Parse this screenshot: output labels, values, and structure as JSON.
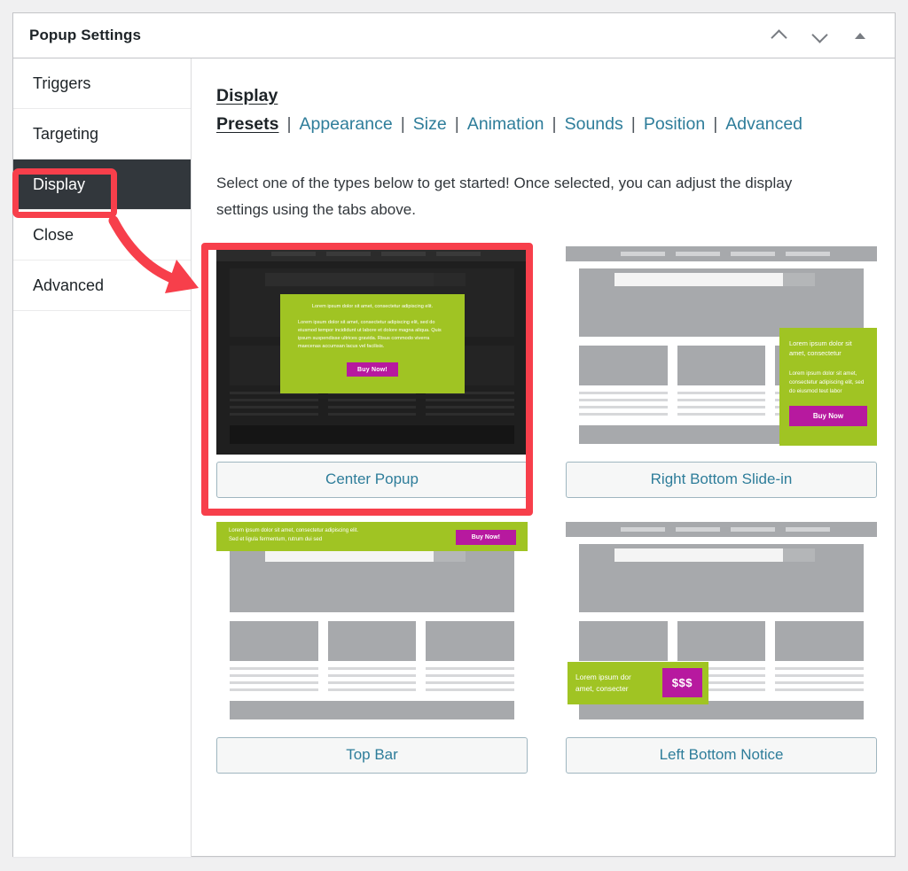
{
  "header": {
    "title": "Popup Settings",
    "controls": [
      {
        "name": "move-up-icon",
        "label": "Move up"
      },
      {
        "name": "move-down-icon",
        "label": "Move down"
      },
      {
        "name": "toggle-panel-icon",
        "label": "Toggle panel"
      }
    ]
  },
  "sidebar": {
    "items": [
      {
        "label": "Triggers",
        "active": false
      },
      {
        "label": "Targeting",
        "active": false
      },
      {
        "label": "Display",
        "active": true
      },
      {
        "label": "Close",
        "active": false
      },
      {
        "label": "Advanced",
        "active": false
      }
    ]
  },
  "tabs": [
    {
      "label": "Display Presets",
      "active": true
    },
    {
      "label": "Appearance",
      "active": false
    },
    {
      "label": "Size",
      "active": false
    },
    {
      "label": "Animation",
      "active": false
    },
    {
      "label": "Sounds",
      "active": false
    },
    {
      "label": "Position",
      "active": false
    },
    {
      "label": "Advanced",
      "active": false
    }
  ],
  "tab_separator": "|",
  "intro": "Select one of the types below to get started! Once selected, you can adjust the display settings using the tabs above.",
  "presets": {
    "center": {
      "label": "Center Popup",
      "selected": true,
      "popup": {
        "heading": "Lorem ipsum dolor sit amet, consectetur adipiscing elit.",
        "body": "Lorem ipsum dolor sit amet, consectetur adipiscing elit, sed do eiusmod tempor incididunt ut labore et dolore magna aliqua. Quis ipsum suspendisse ultrices gravida. Risus commodo viverra maecenas accumsan lacus vel facilisis.",
        "button": "Buy Now!"
      }
    },
    "slidein": {
      "label": "Right Bottom Slide-in",
      "selected": false,
      "popup": {
        "heading": "Lorem ipsum dolor sit amet, consectetur",
        "body": "Lorem ipsum dolor sit amet, consectetur adipiscing elit, sed do eiusmod teut labor",
        "button": "Buy Now"
      }
    },
    "topbar": {
      "label": "Top Bar",
      "selected": false,
      "popup": {
        "line1": "Lorem ipsum dolor sit amet, consectetur adipiscing elit.",
        "line2": "Sed et ligula fermentum, rutrum dui sed",
        "button": "Buy Now!"
      }
    },
    "notice": {
      "label": "Left Bottom Notice",
      "selected": false,
      "popup": {
        "line1": "Lorem ipsum dor",
        "line2": "amet, consecter",
        "button": "$$$"
      }
    }
  },
  "colors": {
    "accent_green": "#a0c423",
    "accent_magenta": "#b7199f",
    "link_blue": "#2e7d9a",
    "active_sidebar": "#32373c",
    "annotation_red": "#f73f4b"
  }
}
